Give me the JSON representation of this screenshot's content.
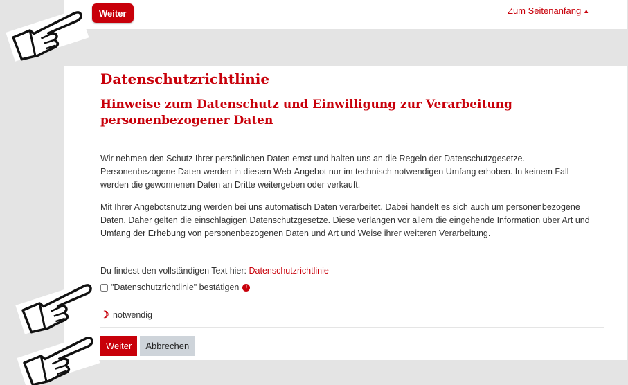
{
  "top": {
    "weiter_label": "Weiter",
    "back_to_top_label": "Zum Seitenanfang",
    "back_to_top_icon": "caret-up-icon"
  },
  "policy": {
    "title": "Datenschutzrichtlinie",
    "subtitle": "Hinweise zum Datenschutz und Einwilligung zur Verarbeitung personenbezogener Daten",
    "paragraph1": "Wir nehmen den Schutz Ihrer persönlichen Daten ernst und halten uns an die Regeln der Datenschutzgesetze. Personenbezogene Daten werden in diesem Web-Angebot nur im technisch notwendigen Umfang erhoben. In keinem Fall werden die gewonnenen Daten an Dritte weitergeben oder verkauft.",
    "paragraph2": "Mit Ihrer Angebotsnutzung werden bei uns automatisch Daten verarbeitet. Dabei handelt es sich auch um personenbezogene Daten. Daher gelten die einschlägigen Datenschutzgesetze. Diese verlangen vor allem die eingehende Information über Art und Umfang der Erhebung von personenbezogenen Daten und Art und Weise ihrer weiteren Verarbeitung.",
    "full_text_prefix": "Du findest den vollständigen Text hier:",
    "full_text_link": "Datenschutzrichtlinie",
    "confirm_label": "\"Datenschutzrichtlinie\" bestätigen",
    "confirm_checked": false,
    "required_icon": "exclamation-circle-icon",
    "required_note": "notwendig",
    "required_note_icon": "crescent-icon"
  },
  "footer": {
    "weiter_label": "Weiter",
    "cancel_label": "Abbrechen"
  },
  "colors": {
    "accent": "#c8000a",
    "background": "#e4e4e4",
    "cancel_bg": "#ced4da"
  },
  "annotations": {
    "pointer_icon": "pointing-hand-icon"
  }
}
